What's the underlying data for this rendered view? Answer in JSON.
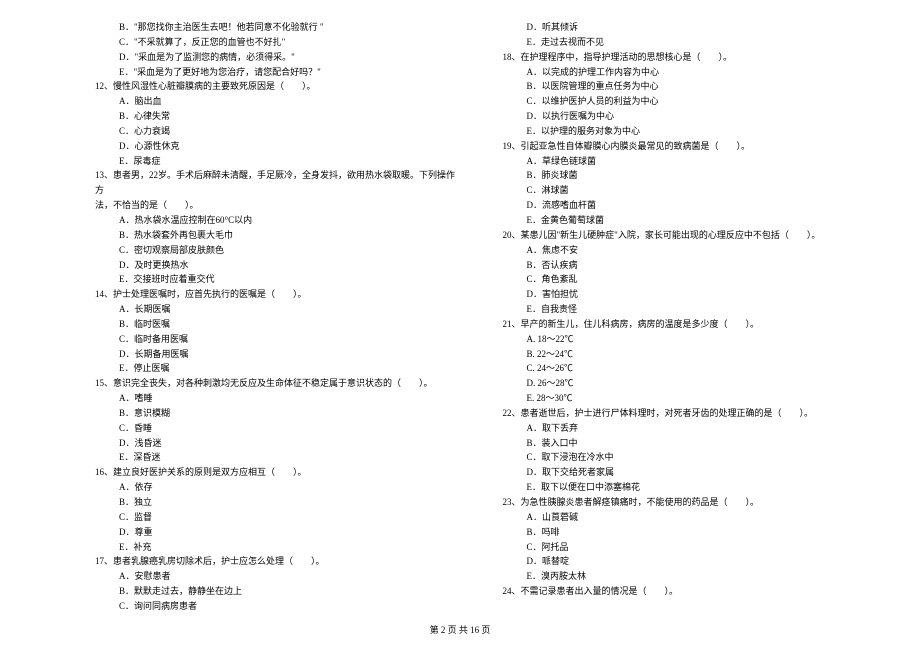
{
  "footer": "第 2 页 共 16 页",
  "left": [
    {
      "cls": "option-line",
      "t": "B．\"那您找你主治医生去吧！他若同意不化验就行 \""
    },
    {
      "cls": "option-line",
      "t": "C．\"不采就算了，反正您的血管也不好扎\""
    },
    {
      "cls": "option-line",
      "t": "D．\"采血是为了监测您的病情，必须得采。\""
    },
    {
      "cls": "option-line",
      "t": "E．\"采血是为了更好地为您治疗，请您配合好吗？\""
    },
    {
      "cls": "question-line",
      "t": "12、慢性风湿性心脏瓣膜病的主要致死原因是（　　）。"
    },
    {
      "cls": "option-line",
      "t": "A．脑出血"
    },
    {
      "cls": "option-line",
      "t": "B．心律失常"
    },
    {
      "cls": "option-line",
      "t": "C．心力衰竭"
    },
    {
      "cls": "option-line",
      "t": "D．心源性休克"
    },
    {
      "cls": "option-line",
      "t": "E．尿毒症"
    },
    {
      "cls": "question-line",
      "t": "13、患者男，22岁。手术后麻醉未清醒，手足厥冷，全身发抖，欲用热水袋取暖。下列操作方"
    },
    {
      "cls": "sub-line",
      "t": "法，不恰当的是（　　）。"
    },
    {
      "cls": "option-line",
      "t": "A．热水袋水温应控制在60°C以内"
    },
    {
      "cls": "option-line",
      "t": "B．热水袋套外再包裹大毛巾"
    },
    {
      "cls": "option-line",
      "t": "C．密切观察局部皮肤颜色"
    },
    {
      "cls": "option-line",
      "t": "D．及时更换热水"
    },
    {
      "cls": "option-line",
      "t": "E．交接班时应着重交代"
    },
    {
      "cls": "question-line",
      "t": "14、护士处理医嘱时，应首先执行的医嘱是（　　）。"
    },
    {
      "cls": "option-line",
      "t": "A．长期医嘱"
    },
    {
      "cls": "option-line",
      "t": "B．临时医嘱"
    },
    {
      "cls": "option-line",
      "t": "C．临时备用医嘱"
    },
    {
      "cls": "option-line",
      "t": "D．长期备用医嘱"
    },
    {
      "cls": "option-line",
      "t": "E．停止医嘱"
    },
    {
      "cls": "question-line",
      "t": "15、意识完全丧失，对各种刺激均无反应及生命体征不稳定属于意识状态的（　　）。"
    },
    {
      "cls": "option-line",
      "t": "A．嗜睡"
    },
    {
      "cls": "option-line",
      "t": "B．意识模糊"
    },
    {
      "cls": "option-line",
      "t": "C．昏睡"
    },
    {
      "cls": "option-line",
      "t": "D．浅昏迷"
    },
    {
      "cls": "option-line",
      "t": "E．深昏迷"
    },
    {
      "cls": "question-line",
      "t": "16、建立良好医护关系的原则是双方应相互（　　）。"
    },
    {
      "cls": "option-line",
      "t": "A．依存"
    },
    {
      "cls": "option-line",
      "t": "B．独立"
    },
    {
      "cls": "option-line",
      "t": "C．监督"
    },
    {
      "cls": "option-line",
      "t": "D．尊重"
    },
    {
      "cls": "option-line",
      "t": "E．补充"
    },
    {
      "cls": "question-line",
      "t": "17、患者乳腺癌乳房切除术后，护士应怎么处理（　　）。"
    },
    {
      "cls": "option-line",
      "t": "A．安慰患者"
    },
    {
      "cls": "option-line",
      "t": "B．默默走过去，静静坐在边上"
    },
    {
      "cls": "option-line",
      "t": "C．询问同病房患者"
    }
  ],
  "right": [
    {
      "cls": "option-line",
      "t": "D．听其倾诉"
    },
    {
      "cls": "option-line",
      "t": "E．走过去视而不见"
    },
    {
      "cls": "question-line",
      "t": "18、在护理程序中，指导护理活动的思想核心是（　　）。"
    },
    {
      "cls": "option-line",
      "t": "A．以完成的护理工作内容为中心"
    },
    {
      "cls": "option-line",
      "t": "B．以医院管理的重点任务为中心"
    },
    {
      "cls": "option-line",
      "t": "C．以维护医护人员的利益为中心"
    },
    {
      "cls": "option-line",
      "t": "D．以执行医嘱为中心"
    },
    {
      "cls": "option-line",
      "t": "E．以护理的服务对象为中心"
    },
    {
      "cls": "question-line",
      "t": "19、引起亚急性自体瓣膜心内膜炎最常见的致病菌是（　　）。"
    },
    {
      "cls": "option-line",
      "t": "A．草绿色链球菌"
    },
    {
      "cls": "option-line",
      "t": "B．肺炎球菌"
    },
    {
      "cls": "option-line",
      "t": "C．淋球菌"
    },
    {
      "cls": "option-line",
      "t": "D．流感嗜血杆菌"
    },
    {
      "cls": "option-line",
      "t": "E．金黄色葡萄球菌"
    },
    {
      "cls": "question-line",
      "t": "20、某患儿因\"新生儿硬肿症\"入院，家长可能出现的心理反应中不包括（　　）。"
    },
    {
      "cls": "option-line",
      "t": "A．焦虑不安"
    },
    {
      "cls": "option-line",
      "t": "B．否认疾病"
    },
    {
      "cls": "option-line",
      "t": "C．角色紊乱"
    },
    {
      "cls": "option-line",
      "t": "D．害怕担忧"
    },
    {
      "cls": "option-line",
      "t": "E．自我责怪"
    },
    {
      "cls": "question-line",
      "t": "21、早产的新生儿，住儿科病房，病房的温度是多少度（　　）。"
    },
    {
      "cls": "option-line",
      "t": "A. 18～22℃"
    },
    {
      "cls": "option-line",
      "t": "B. 22～24℃"
    },
    {
      "cls": "option-line",
      "t": "C. 24～26℃"
    },
    {
      "cls": "option-line",
      "t": "D. 26～28℃"
    },
    {
      "cls": "option-line",
      "t": "E. 28～30℃"
    },
    {
      "cls": "question-line",
      "t": "22、患者逝世后，护士进行尸体料理时，对死者牙齿的处理正确的是（　　）。"
    },
    {
      "cls": "option-line",
      "t": "A．取下丢弃"
    },
    {
      "cls": "option-line",
      "t": "B．装入口中"
    },
    {
      "cls": "option-line",
      "t": "C．取下浸泡在冷水中"
    },
    {
      "cls": "option-line",
      "t": "D．取下交给死者家属"
    },
    {
      "cls": "option-line",
      "t": "E．取下以便在口中添塞棉花"
    },
    {
      "cls": "question-line",
      "t": "23、为急性胰腺炎患者解痉镇痛时，不能使用的药品是（　　）。"
    },
    {
      "cls": "option-line",
      "t": "A．山莨菪碱"
    },
    {
      "cls": "option-line",
      "t": "B．吗啡"
    },
    {
      "cls": "option-line",
      "t": "C．阿托品"
    },
    {
      "cls": "option-line",
      "t": "D．哌替啶"
    },
    {
      "cls": "option-line",
      "t": "E．溴丙胺太林"
    },
    {
      "cls": "question-line",
      "t": "24、不需记录患者出入量的情况是（　　）。"
    }
  ]
}
